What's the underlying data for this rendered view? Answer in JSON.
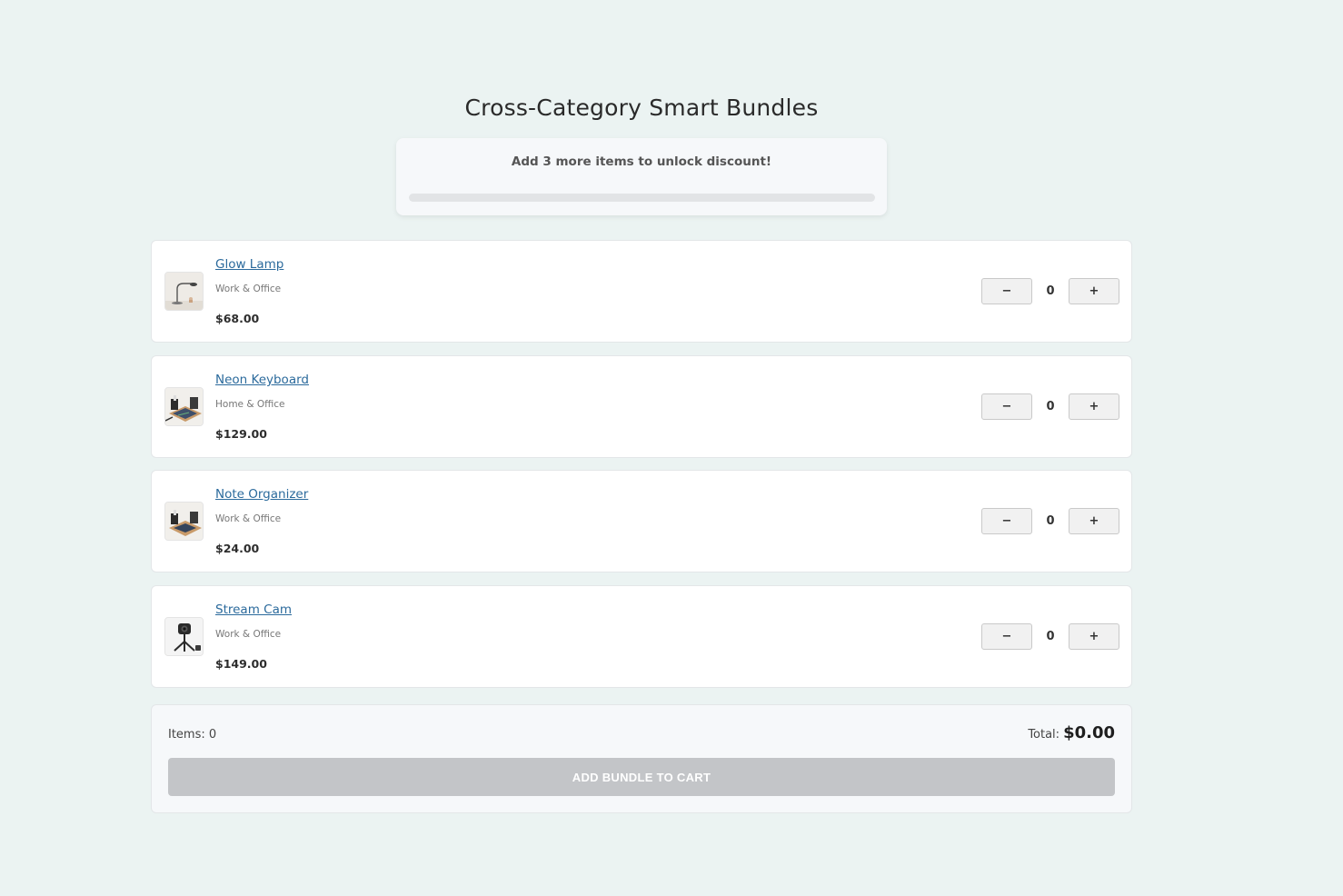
{
  "page": {
    "title": "Cross-Category Smart Bundles"
  },
  "progress": {
    "message": "Add 3 more items to unlock discount!",
    "percent": 0
  },
  "products": [
    {
      "name": "Glow Lamp",
      "category": "Work & Office",
      "price": "$68.00",
      "quantity": "0",
      "thumbnail_icon": "desk-lamp-icon"
    },
    {
      "name": "Neon Keyboard",
      "category": "Home & Office",
      "price": "$129.00",
      "quantity": "0",
      "thumbnail_icon": "desk-organizer-icon"
    },
    {
      "name": "Note Organizer",
      "category": "Work & Office",
      "price": "$24.00",
      "quantity": "0",
      "thumbnail_icon": "desk-organizer-icon"
    },
    {
      "name": "Stream Cam",
      "category": "Work & Office",
      "price": "$149.00",
      "quantity": "0",
      "thumbnail_icon": "webcam-icon"
    }
  ],
  "controls": {
    "decrement_label": "−",
    "increment_label": "+"
  },
  "summary": {
    "items_label": "Items: 0",
    "total_label": "Total:",
    "total_value": "$0.00",
    "add_button_label": "ADD BUNDLE TO CART"
  },
  "colors": {
    "background": "#ebf3f2",
    "link": "#2b6a9c",
    "disabled_button": "#c3c5c8",
    "progress_track": "#e2e4e6"
  }
}
